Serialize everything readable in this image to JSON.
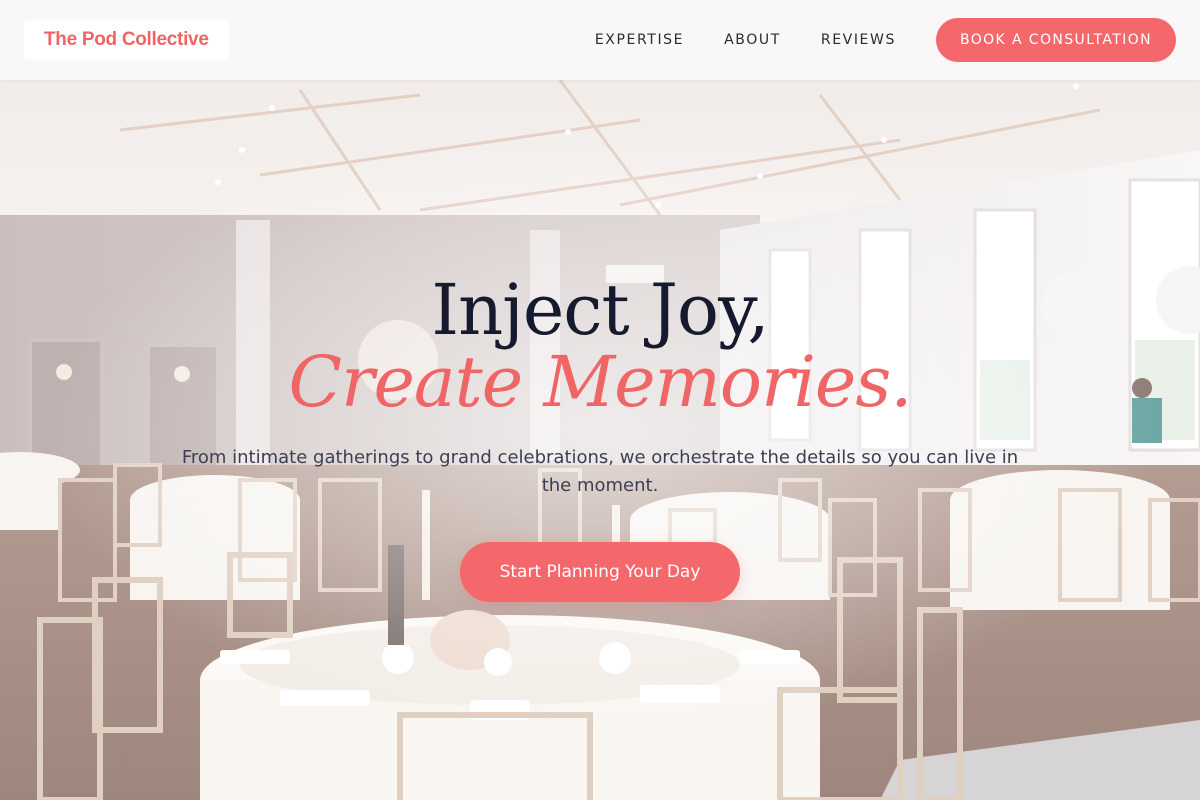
{
  "header": {
    "logo_text": "The Pod Collective",
    "nav": [
      {
        "label": "EXPERTISE"
      },
      {
        "label": "ABOUT"
      },
      {
        "label": "REVIEWS"
      }
    ],
    "cta_label": "BOOK A CONSULTATION"
  },
  "hero": {
    "headline_line1": "Inject Joy,",
    "headline_line2": "Create Memories.",
    "subheadline": "From intimate gatherings to grand celebrations, we orchestrate the details so you can live in the moment.",
    "cta_label": "Start Planning Your Day",
    "background_image": "banquet-hall-photo"
  },
  "colors": {
    "accent": "#f4676a",
    "headline_dark": "#161a2e",
    "body_text": "#3b3f52"
  }
}
